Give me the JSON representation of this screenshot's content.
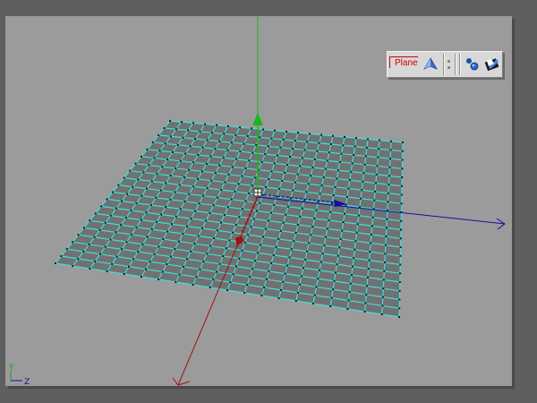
{
  "toolbar": {
    "object_name": "Plane",
    "icons": [
      "plane-tag-icon",
      "dots-menu-icon",
      "render-tag-icon",
      "texture-tag-icon"
    ]
  },
  "axis_indicator": {
    "y_label": "Y",
    "z_label": "Z"
  },
  "colors": {
    "viewport_bg": "#9b9b9b",
    "grid_fill": "#717171",
    "grid_lines": "#3ee0dc",
    "axis_x": "#a01010",
    "axis_y": "#18b818",
    "axis_z": "#1010a0",
    "label_red": "#d00000"
  }
}
